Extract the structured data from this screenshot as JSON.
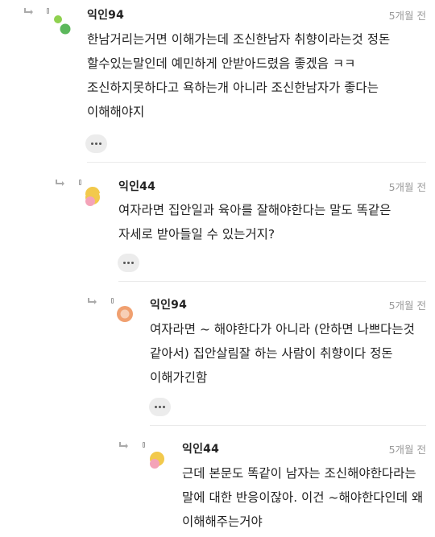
{
  "comments": [
    {
      "author": "익인94",
      "time": "5개월 전",
      "text": "한남거리는거면 이해가는데 조신한남자 취향이라는것 정돈 할수있는말인데 예민하게 안받아드렸음 좋겠음 ㅋㅋ 조신하지못하다고 욕하는개 아니라 조신한남자가 좋다는 이해해야지"
    },
    {
      "author": "익인44",
      "time": "5개월 전",
      "text": "여자라면 집안일과 육아를 잘해야한다는 말도 똑같은 자세로 받아들일 수 있는거지?"
    },
    {
      "author": "익인94",
      "time": "5개월 전",
      "text": "여자라면 ~ 해야한다가 아니라 (안하면 나쁘다는것 같아서) 집안살림잘 하는 사람이 취향이다 정돈 이해가긴함"
    },
    {
      "author": "익인44",
      "time": "5개월 전",
      "text": "근데 본문도 똑같이 남자는 조신해야한다라는 말에 대한 반응이잖아. 이건 ~해야한다인데 왜 이해해주는거야"
    }
  ],
  "icons": {
    "reply": "reply-arrow-icon",
    "more": "more-options-icon"
  },
  "colors": {
    "avatar_green_light": "#8fd14f",
    "avatar_green_dark": "#5cb85c",
    "avatar_yellow": "#f2c94c",
    "avatar_pink": "#f4a3b8",
    "avatar_orange": "#f0a070"
  }
}
